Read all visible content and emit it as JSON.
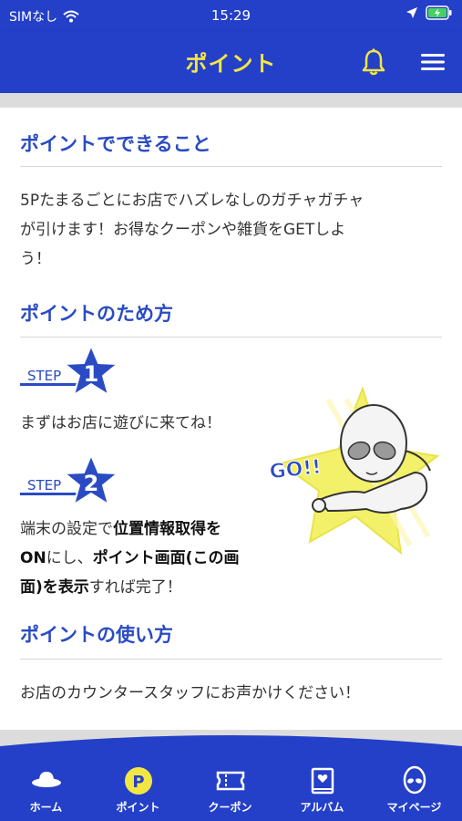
{
  "status": {
    "carrier": "SIMなし",
    "time": "15:29"
  },
  "header": {
    "title": "ポイント"
  },
  "sections": {
    "what": {
      "heading": "ポイントでできること",
      "body_lines": [
        "5Pたまるごとにお店でハズレなしのガチャガチャ",
        "が引けます！お得なクーポンや雑貨をGETしよ",
        "う！"
      ]
    },
    "howto": {
      "heading": "ポイントのため方",
      "step_label": "STEP",
      "step1": {
        "number": "1",
        "text": "まずはお店に遊びに来てね！"
      },
      "step2": {
        "number": "2",
        "line1_a": "端末の設定で",
        "line1_b": "位置情報取得を",
        "line2_a": "ON",
        "line2_b": "にし、",
        "line2_c": "ポイント画面(この画",
        "line3_a": "面)を表示",
        "line3_b": "すれば完了！"
      },
      "illustration_text": "GO!!"
    },
    "usage": {
      "heading": "ポイントの使い方",
      "body": "お店のカウンタースタッフにお声かけください！"
    }
  },
  "bottom_nav": [
    {
      "label": "ホーム",
      "icon": "ufo-icon"
    },
    {
      "label": "ポイント",
      "icon": "point-p-icon",
      "active": true
    },
    {
      "label": "クーポン",
      "icon": "ticket-icon"
    },
    {
      "label": "アルバム",
      "icon": "album-icon"
    },
    {
      "label": "マイページ",
      "icon": "alien-face-icon"
    }
  ],
  "colors": {
    "brand_blue": "#2440c8",
    "accent_yellow": "#f4e642",
    "heading_blue": "#2a4bc3"
  }
}
